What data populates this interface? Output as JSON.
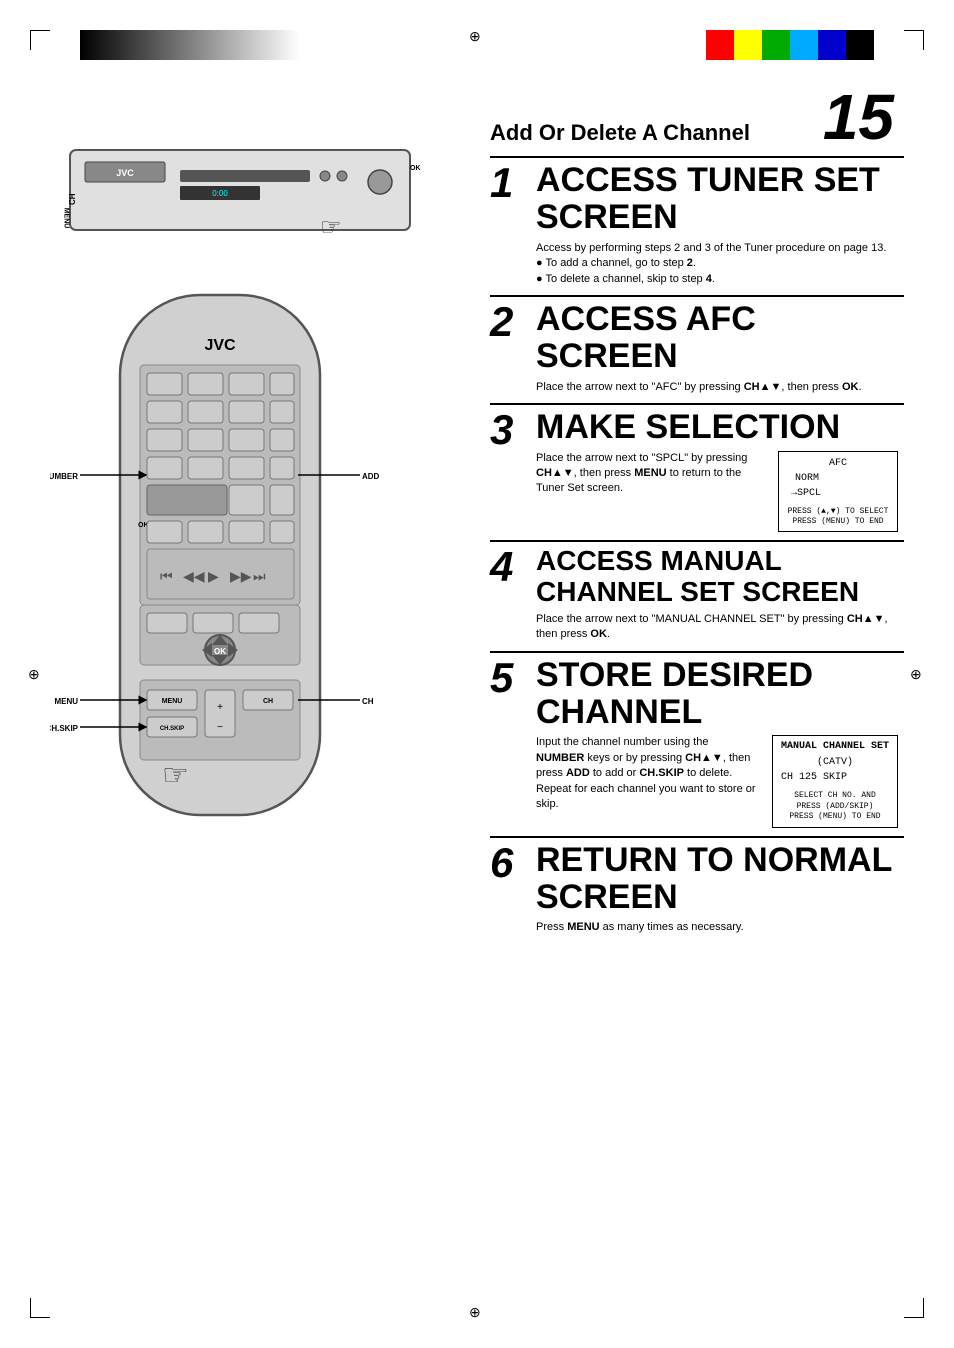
{
  "page": {
    "number": "15",
    "corner_marks": true,
    "color_stripes": [
      "#ff0000",
      "#ffff00",
      "#00aa00",
      "#00aaff",
      "#0000cc",
      "#000000"
    ]
  },
  "header": {
    "title": "Add Or Delete A Channel"
  },
  "steps": [
    {
      "number": "1",
      "title": "ACCESS TUNER SET SCREEN",
      "body": "Access by performing steps 2 and 3 of the Tuner procedure on page 13.",
      "bullets": [
        "To add a channel, go to step 2.",
        "To delete a channel, skip to step 4."
      ]
    },
    {
      "number": "2",
      "title": "ACCESS AFC SCREEN",
      "body": "Place the arrow next to \"AFC\" by pressing CH▲▼, then press OK."
    },
    {
      "number": "3",
      "title": "MAKE SELECTION",
      "body": "Place the arrow next to \"SPCL\" by pressing CH▲▼, then press MENU to return to the Tuner Set screen.",
      "screen": {
        "lines": [
          "AFC",
          "",
          "NORM",
          "→SPCL"
        ],
        "note": "PRESS (▲,▼) TO SELECT\nPRESS (MENU) TO END"
      }
    },
    {
      "number": "4",
      "title": "ACCESS MANUAL CHANNEL SET SCREEN",
      "body": "Place the arrow next to \"MANUAL CHANNEL SET\" by pressing CH▲▼, then press OK."
    },
    {
      "number": "5",
      "title": "STORE DESIRED CHANNEL",
      "body": "Input the channel number using the NUMBER keys or by pressing CH▲▼, then press ADD to add or CH.SKIP to delete. Repeat for each channel you want to store or skip.",
      "screen": {
        "title": "MANUAL CHANNEL SET",
        "lines": [
          "(CATV)",
          "CH  125  SKIP"
        ],
        "note": "SELECT CH NO. AND\nPRESS (ADD/SKIP)\nPRESS (MENU) TO END"
      }
    },
    {
      "number": "6",
      "title": "RETURN TO NORMAL SCREEN",
      "body": "Press MENU as many times as necessary."
    }
  ],
  "labels": {
    "number": "NUMBER",
    "add": "ADD",
    "menu": "MENU",
    "ch": "CH",
    "ch_skip": "CH.SKIP",
    "ok": "OK",
    "jvc": "JVC"
  }
}
